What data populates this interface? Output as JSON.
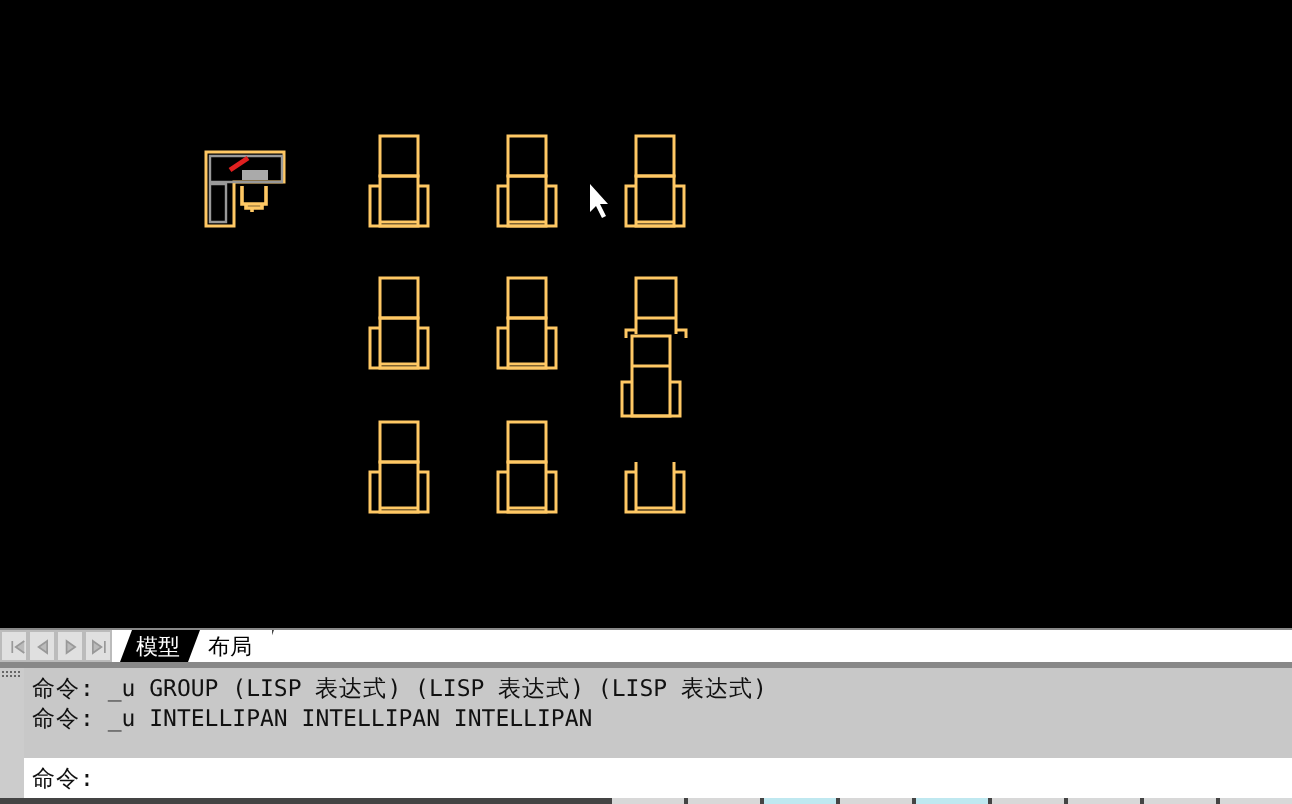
{
  "layout_tabs": [
    {
      "label": "模型",
      "selected": true
    },
    {
      "label": "布局",
      "selected": false
    }
  ],
  "command_history": [
    "命令: _u GROUP (LISP 表达式) (LISP 表达式) (LISP 表达式)",
    "命令: _u INTELLIPAN INTELLIPAN INTELLIPAN"
  ],
  "command_prompt": "命令:"
}
